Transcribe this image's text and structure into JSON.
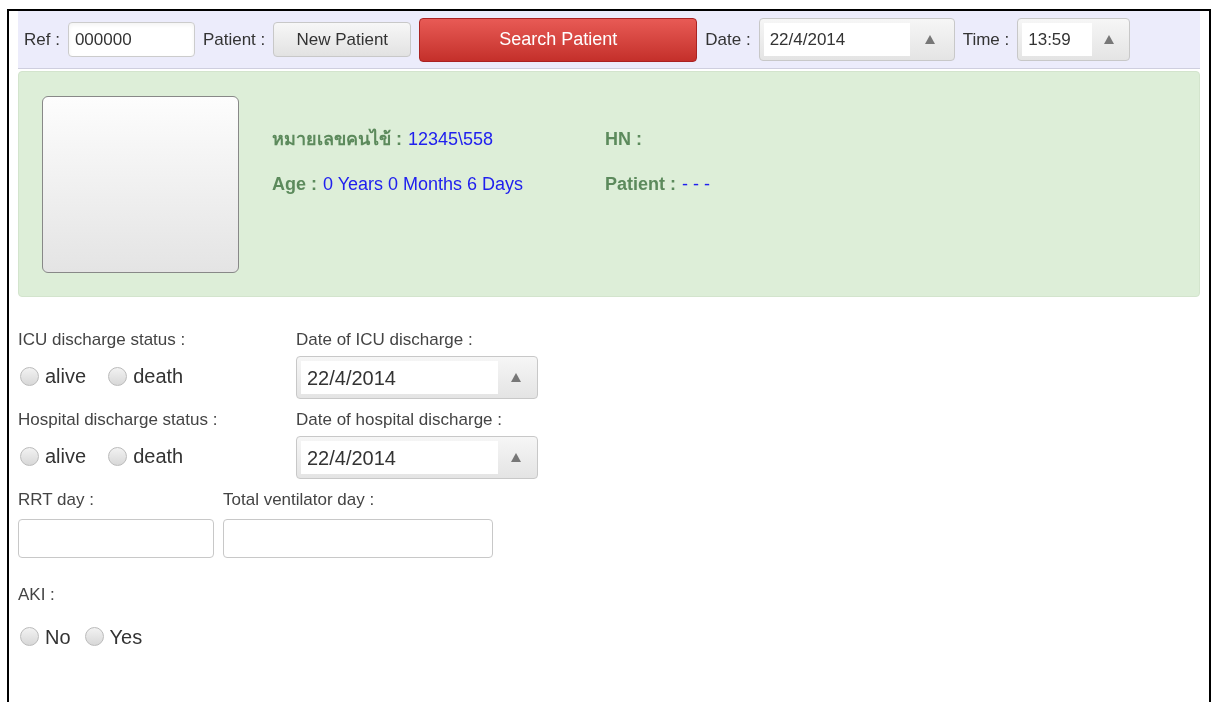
{
  "toolbar": {
    "ref_label": "Ref :",
    "ref_value": "000000",
    "patient_label": "Patient :",
    "new_patient_button": "New Patient",
    "search_button": "Search Patient",
    "date_label": "Date :",
    "date_value": "22/4/2014",
    "time_label": "Time :",
    "time_value": "13:59"
  },
  "patient_info": {
    "fields": [
      {
        "label": "หมายเลขคนไข้ :",
        "value": "12345\\558"
      },
      {
        "label": "HN :"
      },
      {
        "label": "Age :",
        "value": "0 Years 0 Months 6 Days"
      },
      {
        "label": "Patient :",
        "value": "- - -"
      }
    ]
  },
  "discharge": [
    {
      "status_label": "ICU discharge status :",
      "options": [
        {
          "label": "alive",
          "selected": false
        },
        {
          "label": "death",
          "selected": false
        }
      ],
      "date_label": "Date of ICU discharge :",
      "date_value": "22/4/2014"
    },
    {
      "status_label": "Hospital discharge status :",
      "options": [
        {
          "label": "alive",
          "selected": false
        },
        {
          "label": "death",
          "selected": false
        }
      ],
      "date_label": "Date of hospital discharge :",
      "date_value": "22/4/2014"
    }
  ],
  "day_counts": [
    {
      "label": "RRT day :"
    },
    {
      "label": "Total ventilator day :"
    }
  ],
  "aki": {
    "label": "AKI :",
    "options": [
      {
        "label": "No",
        "selected": false
      },
      {
        "label": "Yes",
        "selected": false
      }
    ]
  }
}
